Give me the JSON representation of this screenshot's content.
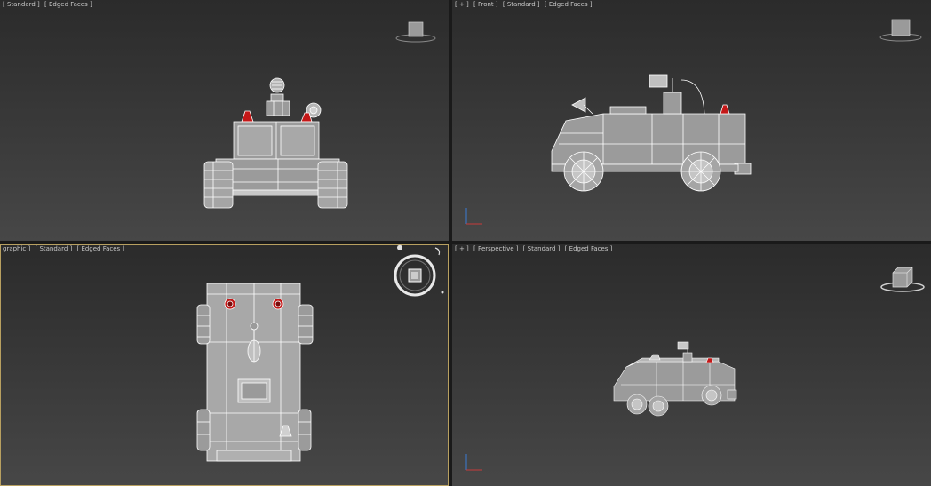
{
  "viewports": {
    "top_left": {
      "label_parts": [
        "[ Standard ]",
        "[ Edged Faces ]"
      ]
    },
    "top_right": {
      "label_parts": [
        "[ + ]",
        "[ Front ]",
        "[ Standard ]",
        "[ Edged Faces ]"
      ]
    },
    "bottom_left": {
      "label_parts": [
        "graphic ]",
        "[ Standard ]",
        "[ Edged Faces ]"
      ]
    },
    "bottom_right": {
      "label_parts": [
        "[ + ]",
        "[ Perspective ]",
        "[ Standard ]",
        "[ Edged Faces ]"
      ]
    }
  },
  "colors": {
    "viewport_bg_top": "#2b2b2b",
    "viewport_bg_bottom": "#474747",
    "active_border": "#b8a060",
    "wireframe": "#ffffff",
    "mesh_fill": "#a9a9a9",
    "siren_red": "#c41818"
  }
}
